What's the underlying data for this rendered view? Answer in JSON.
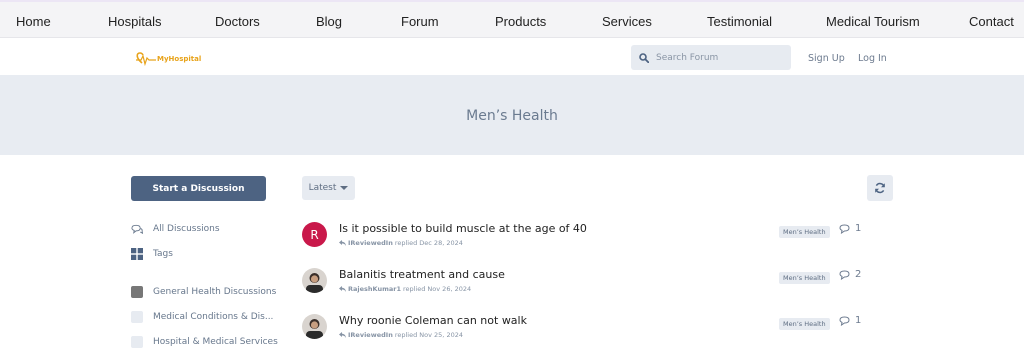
{
  "topnav": {
    "items": [
      "Home",
      "Hospitals",
      "Doctors",
      "Blog",
      "Forum",
      "Products",
      "Services",
      "Testimonial",
      "Medical Tourism",
      "Contact"
    ]
  },
  "header": {
    "logo_text": "MyHospital",
    "search_placeholder": "Search Forum",
    "sign_up": "Sign Up",
    "log_in": "Log In"
  },
  "hero": {
    "title": "Men’s Health"
  },
  "sidebar": {
    "start_button": "Start a Discussion",
    "nav": [
      {
        "label": "All Discussions",
        "icon": "comments-icon"
      },
      {
        "label": "Tags",
        "icon": "tags-grid-icon"
      }
    ],
    "categories": [
      {
        "label": "General Health Discussions",
        "color": "#777777"
      },
      {
        "label": "Medical Conditions & Dis...",
        "color": "#e7ebf1"
      },
      {
        "label": "Hospital & Medical Services",
        "color": "#e7ebf1"
      }
    ]
  },
  "toolbar": {
    "sort_label": "Latest"
  },
  "discussions": [
    {
      "title": "Is it possible to build muscle at the age of 40",
      "user": "IReviewedIn",
      "action": "replied Dec 28, 2024",
      "tag": "Men’s Health",
      "replies": "1",
      "avatar_letter": "R"
    },
    {
      "title": "Balanitis treatment and cause",
      "user": "RajeshKumar1",
      "action": "replied Nov 26, 2024",
      "tag": "Men’s Health",
      "replies": "2",
      "avatar_letter": ""
    },
    {
      "title": "Why roonie Coleman can not walk",
      "user": "IReviewedIn",
      "action": "replied Nov 25, 2024",
      "tag": "Men’s Health",
      "replies": "1",
      "avatar_letter": ""
    }
  ],
  "colors": {
    "accent": "#4d6382",
    "hero_bg": "#e8ecf2",
    "avatar_red": "#c9184a",
    "logo_orange": "#e8a31a"
  }
}
